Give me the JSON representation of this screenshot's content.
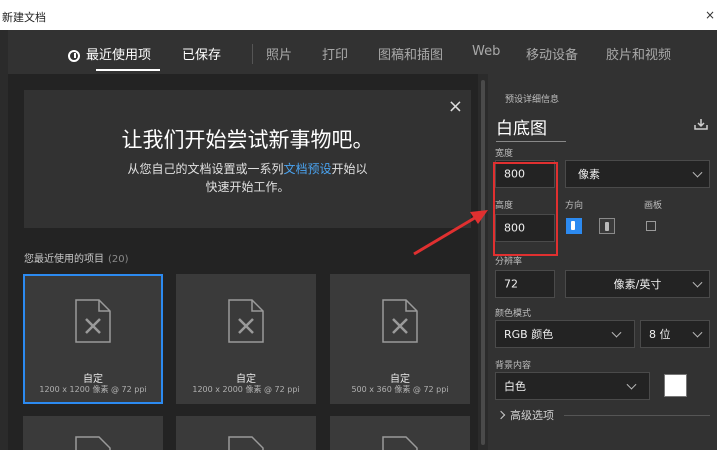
{
  "window": {
    "title": "新建文档",
    "close": "×"
  },
  "nav": {
    "items": [
      {
        "label": "最近使用项",
        "active": true
      },
      {
        "label": "已保存"
      },
      {
        "label": "照片"
      },
      {
        "label": "打印"
      },
      {
        "label": "图稿和插图"
      },
      {
        "label": "Web"
      },
      {
        "label": "移动设备"
      },
      {
        "label": "胶片和视频"
      }
    ]
  },
  "welcome": {
    "close": "×",
    "headline": "让我们开始尝试新事物吧。",
    "line1_pre": "从您自己的文档设置或一系列",
    "line1_link": "文档预设",
    "line1_post": "开始以",
    "line2": "快速开始工作。"
  },
  "recent": {
    "title": "您最近使用的项目",
    "count": "(20)",
    "items": [
      {
        "name": "自定",
        "meta": "1200 x 1200 像素 @ 72 ppi"
      },
      {
        "name": "自定",
        "meta": "1200 x 2000 像素 @ 72 ppi"
      },
      {
        "name": "自定",
        "meta": "500 x 360 像素 @ 72 ppi"
      }
    ]
  },
  "details": {
    "heading": "预设详细信息",
    "preset_name": "白底图",
    "width_label": "宽度",
    "width_value": "800",
    "width_unit": "像素",
    "height_label": "高度",
    "height_value": "800",
    "orientation_label": "方向",
    "artboard_label": "画板",
    "resolution_label": "分辨率",
    "resolution_value": "72",
    "resolution_unit": "像素/英寸",
    "color_mode_label": "颜色模式",
    "color_mode_value": "RGB 颜色",
    "bit_depth": "8 位",
    "background_label": "背景内容",
    "background_value": "白色",
    "background_swatch": "#ffffff",
    "advanced": "高级选项"
  },
  "colors": {
    "accent": "#2c8af0",
    "annotation": "#e03030"
  }
}
